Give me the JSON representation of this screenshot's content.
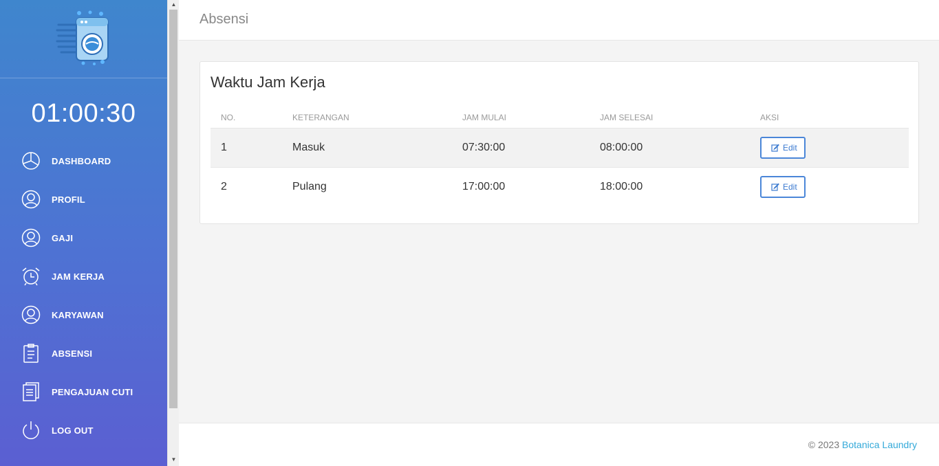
{
  "sidebar": {
    "clock": "01:00:30",
    "items": [
      {
        "label": "DASHBOARD",
        "icon": "pie-chart-icon"
      },
      {
        "label": "PROFIL",
        "icon": "user-circle-icon"
      },
      {
        "label": "GAJI",
        "icon": "user-circle-icon"
      },
      {
        "label": "JAM KERJA",
        "icon": "alarm-clock-icon"
      },
      {
        "label": "KARYAWAN",
        "icon": "user-circle-icon"
      },
      {
        "label": "ABSENSI",
        "icon": "clipboard-icon"
      },
      {
        "label": "PENGAJUAN CUTI",
        "icon": "document-icon"
      },
      {
        "label": "LOG OUT",
        "icon": "power-icon"
      }
    ]
  },
  "header": {
    "title": "Absensi"
  },
  "card": {
    "title": "Waktu Jam Kerja",
    "columns": [
      "NO.",
      "KETERANGAN",
      "JAM MULAI",
      "JAM SELESAI",
      "AKSI"
    ],
    "rows": [
      {
        "no": "1",
        "keterangan": "Masuk",
        "jam_mulai": "07:30:00",
        "jam_selesai": "08:00:00",
        "action": "Edit"
      },
      {
        "no": "2",
        "keterangan": "Pulang",
        "jam_mulai": "17:00:00",
        "jam_selesai": "18:00:00",
        "action": "Edit"
      }
    ]
  },
  "footer": {
    "copyright": "© 2023",
    "brand": "Botanica Laundry"
  },
  "colors": {
    "sidebar_top": "#3f86cd",
    "sidebar_bottom": "#5b5fd2",
    "accent": "#4a86d8",
    "link": "#33a9d9"
  }
}
